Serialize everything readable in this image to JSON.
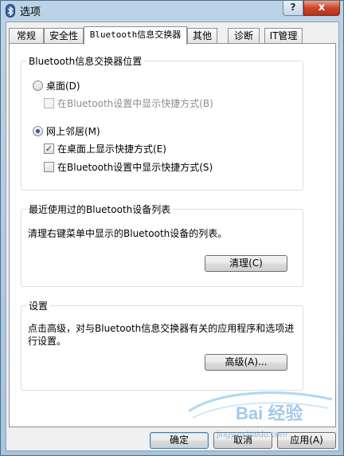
{
  "window": {
    "title": "选项",
    "help_glyph": "?",
    "close_glyph": "x"
  },
  "tabs": [
    {
      "label": "常规"
    },
    {
      "label": "安全性"
    },
    {
      "label": "Bluetooth信息交换器"
    },
    {
      "label": "其他"
    },
    {
      "label": "诊断"
    },
    {
      "label": "IT管理"
    }
  ],
  "location_group": {
    "title": "Bluetooth信息交换器位置",
    "desktop": {
      "label": "桌面(D)",
      "checked": false
    },
    "desktop_shortcut": {
      "label": "在Bluetooth设置中显示快捷方式(B)",
      "checked": false,
      "enabled": false
    },
    "network": {
      "label": "网上邻居(M)",
      "checked": true
    },
    "network_desktop_shortcut": {
      "label": "在桌面上显示快捷方式(E)",
      "checked": true
    },
    "network_bt_shortcut": {
      "label": "在Bluetooth设置中显示快捷方式(S)",
      "checked": false
    }
  },
  "recent_group": {
    "title": "最近使用过的Bluetooth设备列表",
    "description": "清理右键菜单中显示的Bluetooth设备的列表。",
    "clear_button": "清理(C)"
  },
  "settings_group": {
    "title": "设置",
    "description": "点击高级，对与Bluetooth信息交换器有关的应用程序和选项进行设置。",
    "advanced_button": "高级(A)..."
  },
  "footer": {
    "ok_button": "确定",
    "cancel_button": "取消",
    "apply_button": "应用(A)"
  },
  "watermark": {
    "text": "Bai 经验",
    "subtext": "jingyan.baidu.com"
  },
  "colors": {
    "accent": "#2b5a9a",
    "close": "#c8462a",
    "titlebar": "#bcd3e6"
  }
}
